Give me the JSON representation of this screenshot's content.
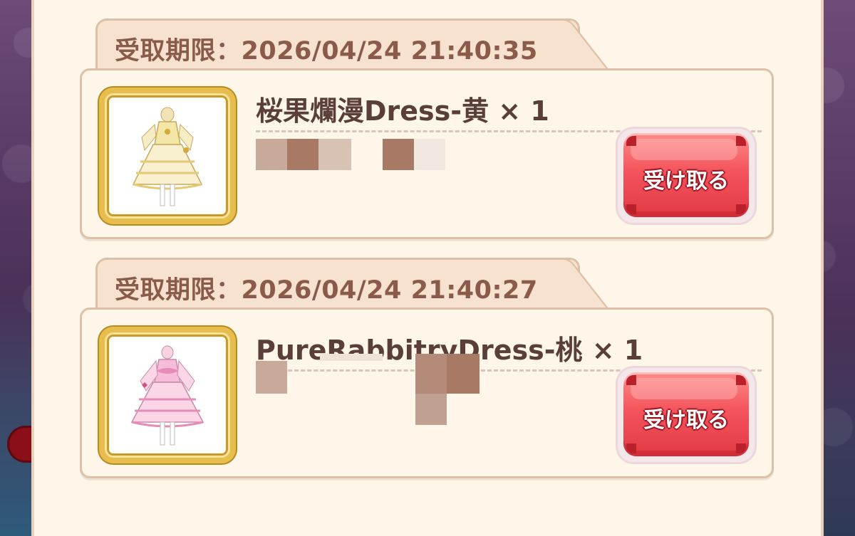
{
  "items": [
    {
      "deadline_text": "受取期限：2026/04/24 21:40:35",
      "name": "桜果爛漫Dress-黄 × 1",
      "claim_label": "受け取る",
      "dress_color": "#f3e6a6",
      "dress_accent": "#e7c974"
    },
    {
      "deadline_text": "受取期限：2026/04/24 21:40:27",
      "name": "PureRabbitryDress-桃 × 1",
      "claim_label": "受け取る",
      "dress_color": "#f6bcd8",
      "dress_accent": "#e68cb8"
    }
  ],
  "colors": {
    "panel_bg": "#fdf6e9",
    "panel_border": "#dcc1a6",
    "deadline_text": "#8a5a4a",
    "item_name": "#5a3e3a",
    "button_red": "#f4545c"
  },
  "icons": {
    "item_thumbnail": "dress-icon"
  }
}
